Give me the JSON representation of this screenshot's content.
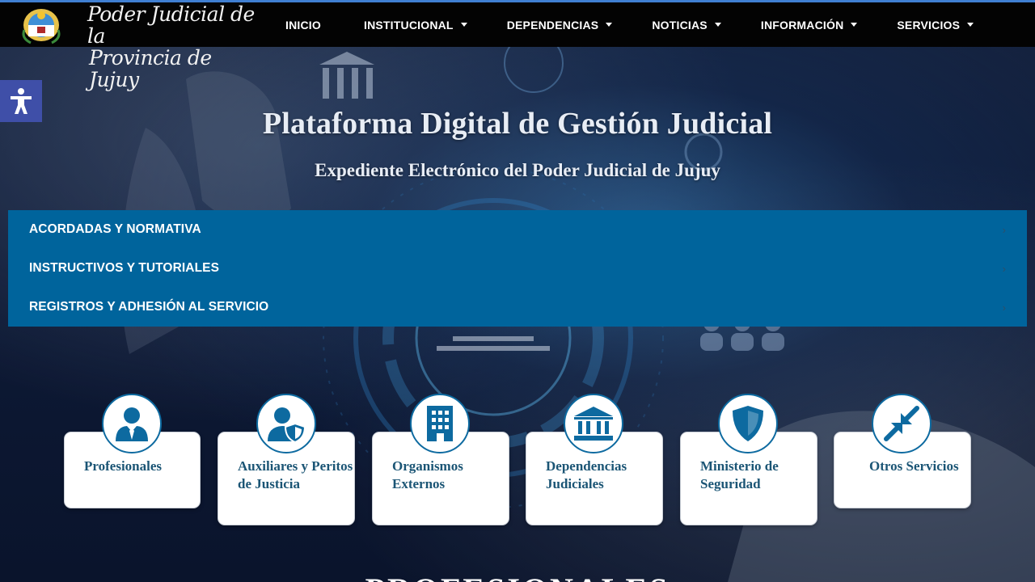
{
  "header": {
    "brand_line1": "Poder Judicial de la",
    "brand_line2": "Provincia de Jujuy",
    "nav": [
      {
        "label": "INICIO",
        "has_dropdown": false
      },
      {
        "label": "INSTITUCIONAL",
        "has_dropdown": true
      },
      {
        "label": "DEPENDENCIAS",
        "has_dropdown": true
      },
      {
        "label": "NOTICIAS",
        "has_dropdown": true
      },
      {
        "label": "INFORMACIÓN",
        "has_dropdown": true
      },
      {
        "label": "SERVICIOS",
        "has_dropdown": true
      }
    ]
  },
  "accessibility": {
    "icon": "accessibility-icon"
  },
  "hero": {
    "title": "Plataforma Digital de Gestión Judicial",
    "subtitle": "Expediente Electrónico del Poder Judicial de Jujuy"
  },
  "accordion": [
    {
      "label": "ACORDADAS Y NORMATIVA"
    },
    {
      "label": "INSTRUCTIVOS Y TUTORIALES"
    },
    {
      "label": "REGISTROS Y ADHESIÓN AL SERVICIO"
    }
  ],
  "cards": [
    {
      "label": "Profesionales",
      "icon": "user-tie-icon"
    },
    {
      "label": "Auxiliares y Peritos de Justicia",
      "icon": "user-shield-icon"
    },
    {
      "label": "Organismos Externos",
      "icon": "building-icon"
    },
    {
      "label": "Dependencias Judiciales",
      "icon": "courthouse-icon"
    },
    {
      "label": "Ministerio de Seguridad",
      "icon": "shield-icon"
    },
    {
      "label": "Otros Servicios",
      "icon": "compress-arrows-icon"
    }
  ],
  "section_heading": "PROFESIONALES",
  "colors": {
    "header_bg": "#030303",
    "accordion_bg": "#00649c",
    "card_text": "#1b5575",
    "icon_blue": "#0d6aa0",
    "a11y_bg": "#3f4fa8"
  }
}
